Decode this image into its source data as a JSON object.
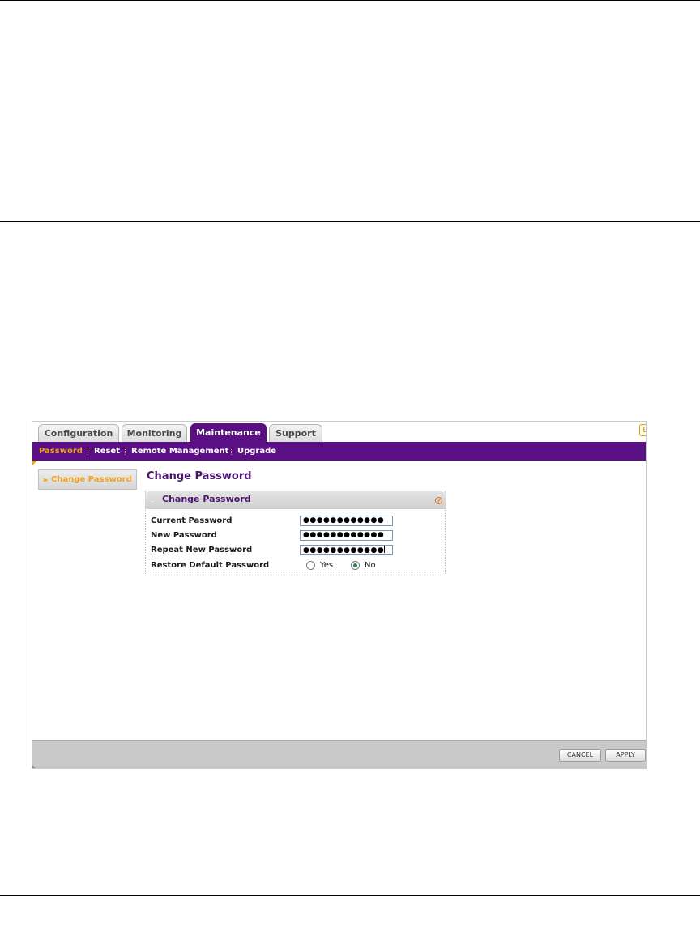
{
  "tabs": [
    {
      "label": "Configuration",
      "active": false
    },
    {
      "label": "Monitoring",
      "active": false
    },
    {
      "label": "Maintenance",
      "active": true
    },
    {
      "label": "Support",
      "active": false
    }
  ],
  "corner_button": {
    "label": "L"
  },
  "subnav": [
    {
      "label": "Password",
      "active": true
    },
    {
      "label": "Reset",
      "active": false
    },
    {
      "label": "Remote Management",
      "active": false
    },
    {
      "label": "Upgrade",
      "active": false
    }
  ],
  "sidebar": {
    "label": "Change Password"
  },
  "page_title": "Change Password",
  "panel": {
    "title": "Change Password",
    "help_label": "?",
    "fields": [
      {
        "label": "Current Password",
        "value": "●●●●●●●●●●●●"
      },
      {
        "label": "New Password",
        "value": "●●●●●●●●●●●●"
      },
      {
        "label": "Repeat New Password",
        "value": "●●●●●●●●●●●●"
      }
    ],
    "restore": {
      "label": "Restore Default Password",
      "options": [
        {
          "label": "Yes",
          "selected": false
        },
        {
          "label": "No",
          "selected": true
        }
      ]
    }
  },
  "buttons": {
    "cancel": "CANCEL",
    "apply": "APPLY"
  },
  "colors": {
    "brand_purple": "#5b0f85",
    "accent_orange": "#f4a21a"
  }
}
